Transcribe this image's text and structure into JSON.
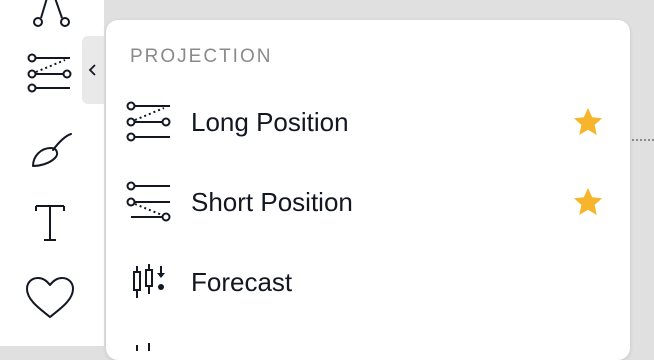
{
  "toolbar": {
    "tools": [
      {
        "name": "pattern-tool",
        "icon": "pattern-icon"
      },
      {
        "name": "projection-tool",
        "icon": "long-position-icon"
      },
      {
        "name": "brush-tool",
        "icon": "brush-icon"
      },
      {
        "name": "text-tool",
        "icon": "text-icon"
      },
      {
        "name": "favorites-tool",
        "icon": "heart-icon"
      }
    ],
    "expand_icon": "chevron-left-icon"
  },
  "menu": {
    "section_title": "PROJECTION",
    "items": [
      {
        "label": "Long Position",
        "icon": "long-position-icon",
        "favorite": true
      },
      {
        "label": "Short Position",
        "icon": "short-position-icon",
        "favorite": true
      },
      {
        "label": "Forecast",
        "icon": "forecast-icon",
        "favorite": false
      }
    ]
  },
  "colors": {
    "star": "#f7b52c",
    "text": "#131722",
    "section_title": "#8a8a8a"
  }
}
